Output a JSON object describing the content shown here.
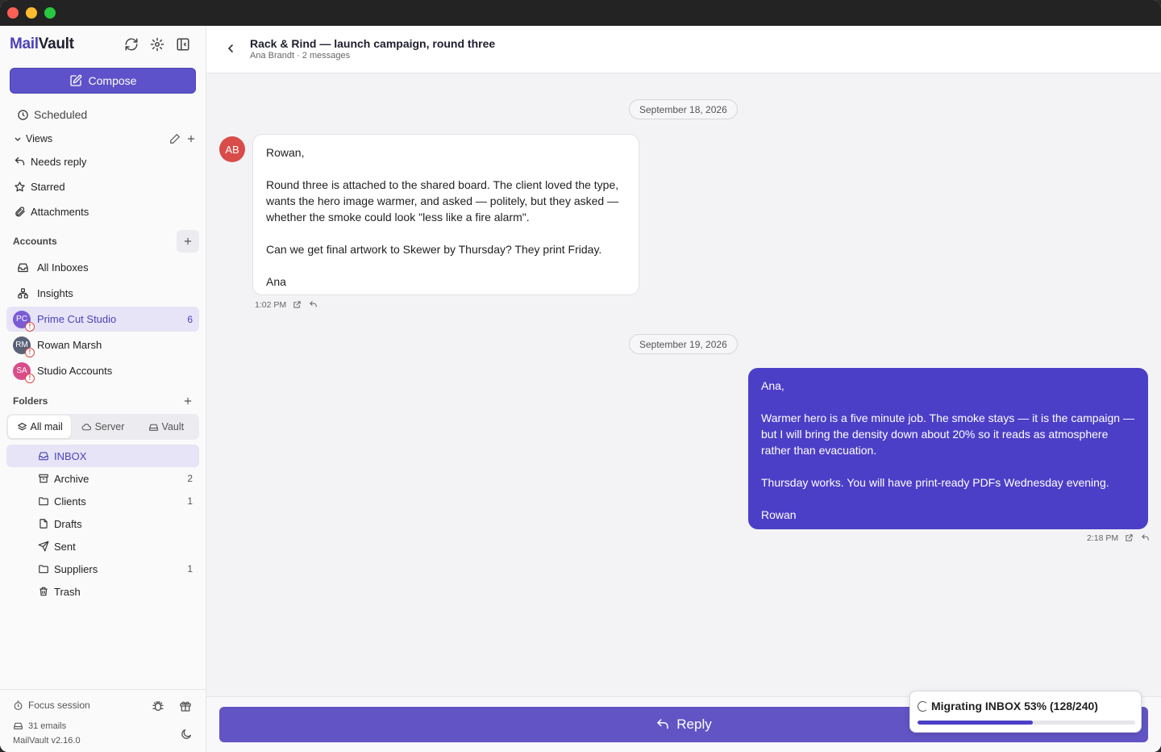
{
  "app": {
    "brand_mail": "Mail",
    "brand_vault": "Vault"
  },
  "sidebar": {
    "compose_label": "Compose",
    "scheduled_label": "Scheduled",
    "views_label": "Views",
    "views": [
      {
        "label": "Needs reply",
        "icon": "reply-icon"
      },
      {
        "label": "Starred",
        "icon": "star-icon"
      },
      {
        "label": "Attachments",
        "icon": "paperclip-icon"
      }
    ],
    "accounts_label": "Accounts",
    "all_inboxes_label": "All Inboxes",
    "insights_label": "Insights",
    "accounts": [
      {
        "initials": "PC",
        "label": "Prime Cut Studio",
        "count": "6",
        "color": "#7b5cd6",
        "selected": true
      },
      {
        "initials": "RM",
        "label": "Rowan Marsh",
        "count": "",
        "color": "#5a6178",
        "selected": false
      },
      {
        "initials": "SA",
        "label": "Studio Accounts",
        "count": "",
        "color": "#d94c8a",
        "selected": false
      }
    ],
    "folders_label": "Folders",
    "segments": [
      {
        "label": "All mail",
        "active": true
      },
      {
        "label": "Server",
        "active": false
      },
      {
        "label": "Vault",
        "active": false
      }
    ],
    "folders": [
      {
        "label": "INBOX",
        "count": "",
        "icon": "inbox-icon"
      },
      {
        "label": "Archive",
        "count": "2",
        "icon": "archive-icon"
      },
      {
        "label": "Clients",
        "count": "1",
        "icon": "folder-icon"
      },
      {
        "label": "Drafts",
        "count": "",
        "icon": "draft-icon"
      },
      {
        "label": "Sent",
        "count": "",
        "icon": "send-icon"
      },
      {
        "label": "Suppliers",
        "count": "1",
        "icon": "folder-icon"
      },
      {
        "label": "Trash",
        "count": "",
        "icon": "trash-icon"
      }
    ],
    "footer": {
      "focus_label": "Focus session",
      "emails_label": "31 emails",
      "version_label": "MailVault v2.16.0"
    }
  },
  "thread": {
    "subject": "Rack & Rind — launch campaign, round three",
    "meta": "Ana Brandt · 2 messages",
    "messages": [
      {
        "date": "September 18, 2026",
        "avatar": "AB",
        "avatar_color": "#d94c4a",
        "paragraphs": [
          "Rowan,",
          "Round three is attached to the shared board. The client loved the type, wants the hero image warmer, and asked — politely, but they asked — whether the smoke could look \"less like a fire alarm\".",
          "Can we get final artwork to Skewer by Thursday? They print Friday.",
          "Ana"
        ],
        "time": "1:02 PM"
      },
      {
        "date": "September 19, 2026",
        "paragraphs": [
          "Ana,",
          "Warmer hero is a five minute job. The smoke stays — it is the campaign — but I will bring the density down about 20% so it reads as atmosphere rather than evacuation.",
          "Thursday works. You will have print-ready PDFs Wednesday evening.",
          "Rowan"
        ],
        "time": "2:18 PM"
      }
    ],
    "reply_label": "Reply"
  },
  "toast": {
    "text": "Migrating INBOX 53% (128/240)",
    "progress": 0.53
  },
  "colors": {
    "accent": "#5d52c9",
    "outgoing_bubble": "#4b3fc7",
    "reply_button": "#6254c4"
  }
}
